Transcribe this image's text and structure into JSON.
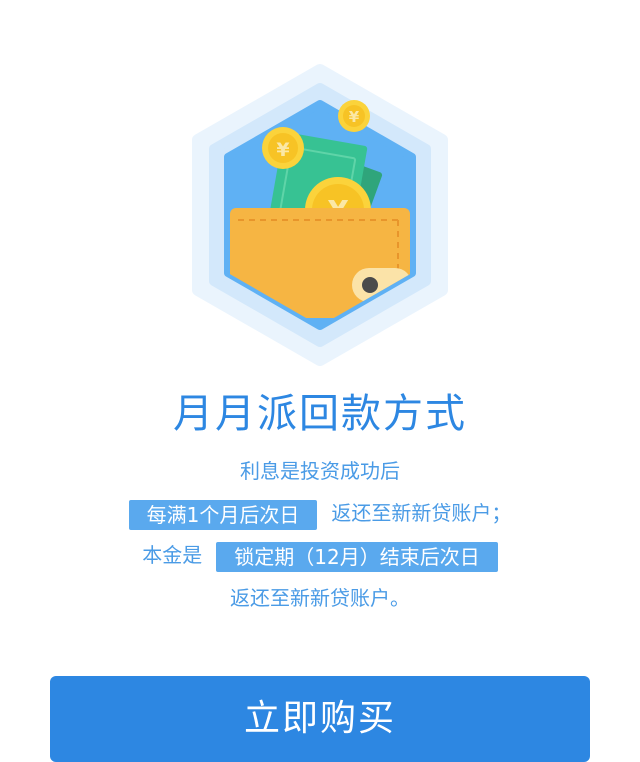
{
  "illustration": {
    "icon": "wallet-with-money-icon",
    "colors": {
      "hexagon_outer": "#eaf4fd",
      "hexagon_mid": "#d3e8fb",
      "hexagon_inner": "#5fb1f4",
      "wallet": "#f6b543",
      "money": "#37c293",
      "coin": "#fbd33b"
    }
  },
  "title": "月月派回款方式",
  "description": {
    "line1": "利息是投资成功后",
    "highlight1": "每满1个月后次日",
    "after_highlight1": "返还至新新贷账户；",
    "before_highlight2": "本金是",
    "highlight2": "锁定期（12月）结束后次日",
    "line4": "返还至新新贷账户。"
  },
  "buy_button": {
    "label": "立即购买"
  },
  "colors": {
    "accent": "#2d87e2",
    "text": "#4a9be6",
    "highlight_bg": "#5aa9ee"
  }
}
